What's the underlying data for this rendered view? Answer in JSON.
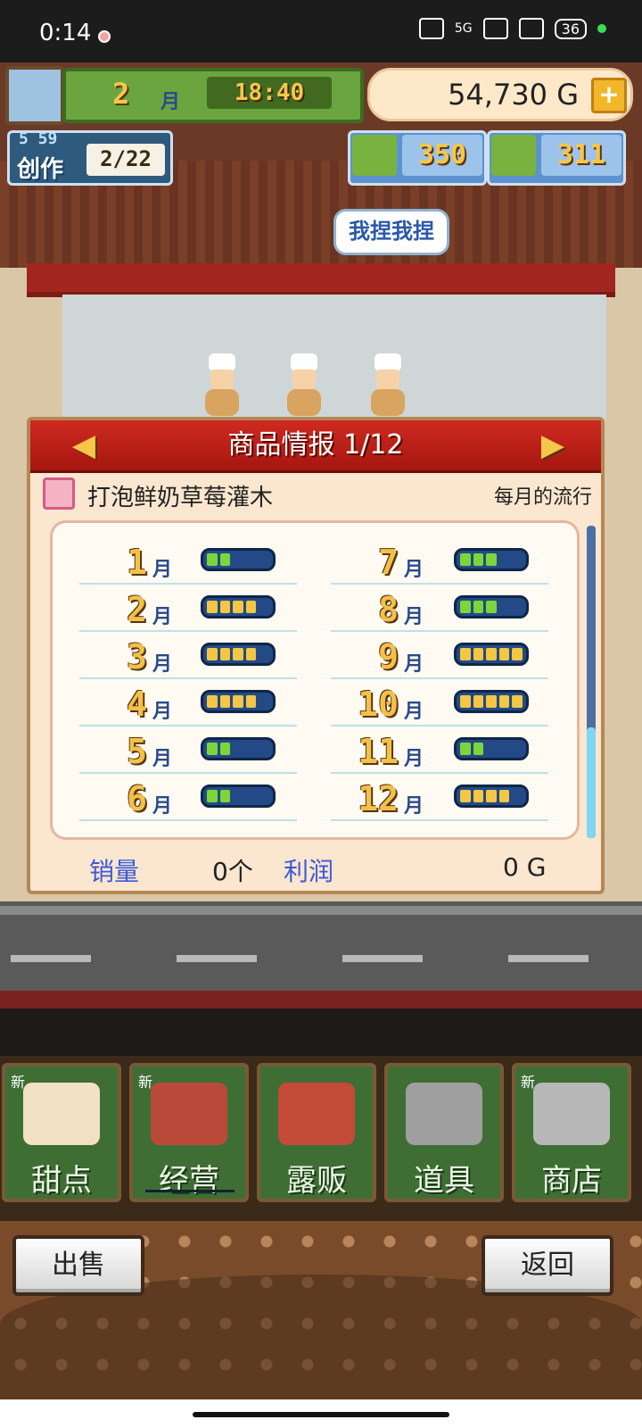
{
  "status": {
    "time": "0:14",
    "network": "5G",
    "battery": "36"
  },
  "hud": {
    "month_number": "2",
    "month_unit": "月",
    "clock": "18:40",
    "money": "54,730 G",
    "money_add": "+",
    "craft": {
      "timer": "5 59",
      "label": "创作",
      "progress": "2/22"
    },
    "resources": [
      {
        "icon": "gold-bar-icon",
        "value": "350"
      },
      {
        "icon": "silver-medal-icon",
        "value": "311"
      }
    ]
  },
  "scene": {
    "speech_bubble": "我捏我捏"
  },
  "panel": {
    "prev": "◀",
    "next": "▶",
    "title": "商品情报 1/12",
    "product_name": "打泡鲜奶草莓灌木",
    "trend_label": "每月的流行",
    "month_unit": "月",
    "months": [
      {
        "num": "1",
        "level": 2
      },
      {
        "num": "2",
        "level": 4
      },
      {
        "num": "3",
        "level": 4
      },
      {
        "num": "4",
        "level": 4
      },
      {
        "num": "5",
        "level": 2
      },
      {
        "num": "6",
        "level": 2
      },
      {
        "num": "7",
        "level": 3
      },
      {
        "num": "8",
        "level": 3
      },
      {
        "num": "9",
        "level": 5
      },
      {
        "num": "10",
        "level": 5
      },
      {
        "num": "11",
        "level": 2
      },
      {
        "num": "12",
        "level": 4
      }
    ],
    "sales_label": "销量",
    "sales_value": "0个",
    "profit_label": "利润",
    "profit_value": "0 G"
  },
  "menu": [
    {
      "label": "甜点",
      "new": "新",
      "icon": "cake-icon"
    },
    {
      "label": "经营",
      "new": "新",
      "icon": "shop-icon"
    },
    {
      "label": "露贩",
      "new": "",
      "icon": "food-truck-icon"
    },
    {
      "label": "道具",
      "new": "",
      "icon": "items-bag-icon"
    },
    {
      "label": "商店",
      "new": "新",
      "icon": "shopping-cart-icon"
    }
  ],
  "buttons": {
    "sell": "出售",
    "back": "返回"
  },
  "colors": {
    "meter_green": "#7cd63a",
    "meter_gold": "#f3c644",
    "meter_empty": "#234a86",
    "panel_red": "#cf2a20"
  }
}
